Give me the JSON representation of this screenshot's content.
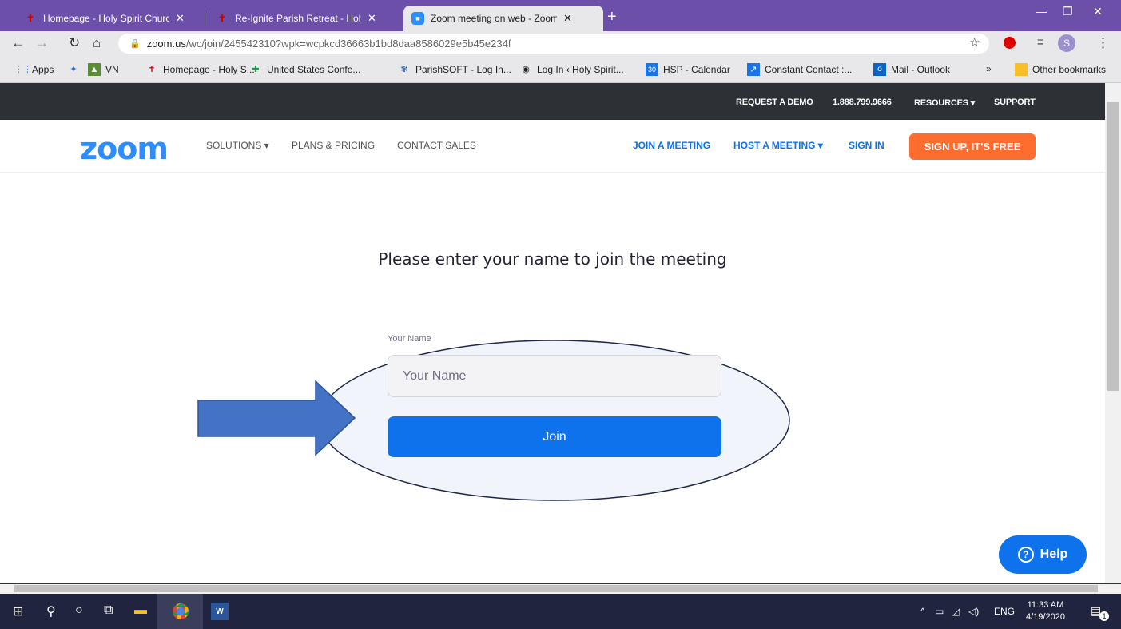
{
  "browser": {
    "tabs": [
      {
        "title": "Homepage - Holy Spirit Church",
        "active": false
      },
      {
        "title": "Re-Ignite Parish Retreat - Holy Sp",
        "active": false
      },
      {
        "title": "Zoom meeting on web - Zoom",
        "active": true
      }
    ],
    "url_host": "zoom.us",
    "url_path": "/wc/join/245542310?wpk=wcpkcd36663b1bd8daa8586029e5b45e234f",
    "profile_initial": "S",
    "bookmarks": [
      "Apps",
      "VN",
      "Homepage - Holy S...",
      "United States Confe...",
      "ParishSOFT - Log In...",
      "Log In ‹ Holy Spirit...",
      "HSP - Calendar",
      "Constant Contact :...",
      "Mail - Outlook",
      "»",
      "Other bookmarks"
    ],
    "calendar_icon_text": "30"
  },
  "zoom": {
    "topbar": {
      "request_demo": "REQUEST A DEMO",
      "phone": "1.888.799.9666",
      "resources": "RESOURCES ▾",
      "support": "SUPPORT"
    },
    "logo": "zoom",
    "nav_left": [
      "SOLUTIONS ▾",
      "PLANS & PRICING",
      "CONTACT SALES"
    ],
    "nav_right": [
      "JOIN A MEETING",
      "HOST A MEETING ▾",
      "SIGN IN"
    ],
    "signup": "SIGN UP, IT'S FREE",
    "heading": "Please enter your name to join the meeting",
    "name_label": "Your Name",
    "name_placeholder": "Your Name",
    "join_button": "Join",
    "help_button": "Help"
  },
  "taskbar": {
    "language": "ENG",
    "time": "11:33 AM",
    "date": "4/19/2020",
    "notification_count": "1"
  },
  "colors": {
    "tabbar": "#6b4fa8",
    "zoom_blue": "#0e72ed",
    "signup_orange": "#ff6d2e",
    "annotation_oval_fill": "#f1f4fa",
    "annotation_arrow": "#4472c4"
  }
}
